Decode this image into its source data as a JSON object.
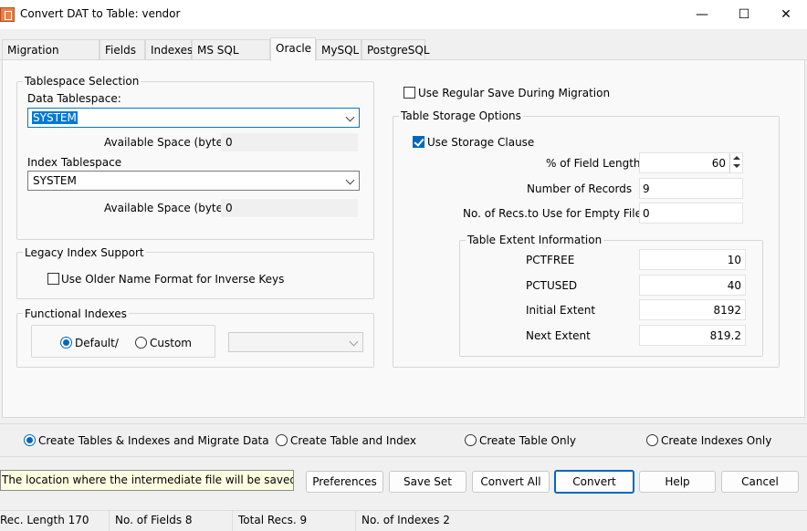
{
  "window": {
    "title": "Convert DAT to Table: vendor",
    "minimize": "—",
    "maximize": "☐",
    "close": "✕"
  },
  "tabs": [
    {
      "label": "Migration Options"
    },
    {
      "label": "Fields"
    },
    {
      "label": "Indexes"
    },
    {
      "label": "MS SQL Server"
    },
    {
      "label": "Oracle"
    },
    {
      "label": "MySQL"
    },
    {
      "label": "PostgreSQL"
    }
  ],
  "active_tab": "Oracle",
  "tablespace": {
    "group_label": "Tablespace Selection",
    "data_label": "Data Tablespace:",
    "data_value": "SYSTEM",
    "avail_label": "Available Space (bytes)",
    "data_avail": "0",
    "index_label": "Index Tablespace",
    "index_value": "SYSTEM",
    "index_avail": "0"
  },
  "legacy": {
    "group_label": "Legacy Index Support",
    "checkbox_label": "Use Older Name Format for Inverse Keys",
    "checked": false
  },
  "functional": {
    "group_label": "Functional Indexes",
    "radio1": "Default/",
    "radio2": "Custom S",
    "selected": "Default/",
    "combo_value": ""
  },
  "regular_save": {
    "label": "Use Regular Save During Migration",
    "checked": false
  },
  "storage": {
    "group_label": "Table Storage Options",
    "clause_label": "Use Storage Clause",
    "clause_checked": true,
    "pct_label": "% of Field Length",
    "pct_value": "60",
    "records_label": "Number of Records",
    "records_value": "9",
    "empty_label": "No. of  Recs.to  Use for Empty Files",
    "empty_value": "0"
  },
  "extent": {
    "group_label": "Table Extent Information",
    "pctfree_label": "PCTFREE",
    "pctfree_value": "10",
    "pctused_label": "PCTUSED",
    "pctused_value": "40",
    "initial_label": "Initial Extent",
    "initial_value": "8192",
    "next_label": "Next Extent",
    "next_value": "819.2"
  },
  "modes": {
    "selected": "Create Tables & Indexes and Migrate Data",
    "options": [
      "Create Tables & Indexes and Migrate Data",
      "Create Table and Index",
      "Create Table Only",
      "Create Indexes Only"
    ]
  },
  "hint": "The location where the intermediate file will be saved",
  "buttons": {
    "preferences": "Preferences",
    "save_set": "Save Set",
    "convert_all": "Convert All",
    "convert": "Convert",
    "help": "Help",
    "cancel": "Cancel"
  },
  "status": {
    "rec_length": "Rec. Length 170",
    "fields": "No. of Fields 8",
    "total_recs": "Total Recs. 9",
    "indexes": "No. of Indexes 2"
  }
}
